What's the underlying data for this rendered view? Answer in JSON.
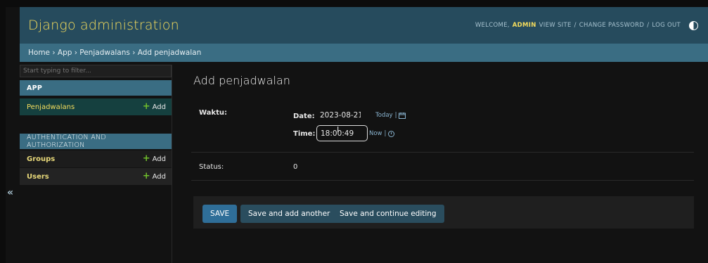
{
  "header": {
    "brand": "Django administration",
    "welcome": "WELCOME,",
    "username": "ADMIN",
    "view_site": "VIEW SITE",
    "change_password": "CHANGE PASSWORD",
    "log_out": "LOG OUT",
    "sep": "/"
  },
  "breadcrumbs": "Home › App › Penjadwalans › Add penjadwalan",
  "sidebar": {
    "filter_placeholder": "Start typing to filter...",
    "app_caption": "APP",
    "penjadwalans": "Penjadwalans",
    "add": "Add",
    "auth_caption": "AUTHENTICATION AND AUTHORIZATION",
    "groups": "Groups",
    "users": "Users",
    "collapse": "«"
  },
  "content": {
    "title": "Add penjadwalan",
    "waktu_label": "Waktu:",
    "date_label": "Date:",
    "date_value": "2023-08-21",
    "today": "Today",
    "time_label": "Time:",
    "time_value": "18:00:49",
    "now": "Now",
    "pipe": "|",
    "status_label": "Status:",
    "status_value": "0"
  },
  "submit": {
    "save": "SAVE",
    "save_add": "Save and add another",
    "save_continue": "Save and continue editing"
  },
  "colors": {
    "header": "#264b5d",
    "breadcrumbs": "#3a6d83",
    "brand": "#f5dd5d",
    "add_plus": "#70bf2b"
  }
}
